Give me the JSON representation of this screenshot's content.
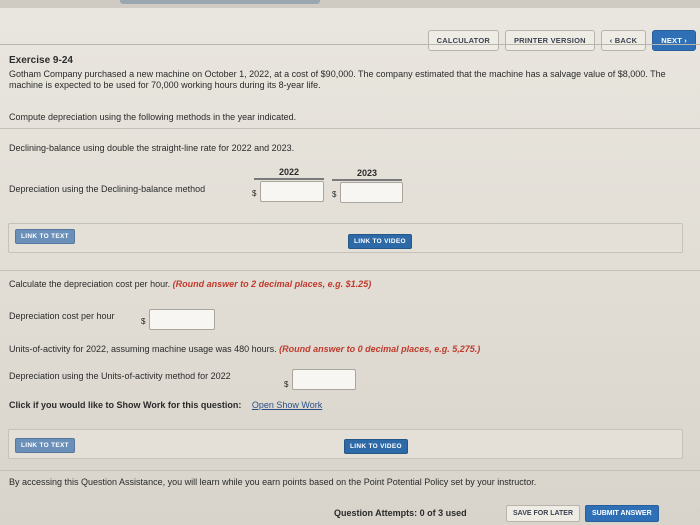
{
  "toolbar": {
    "calculator": "CALCULATOR",
    "printer_version": "PRINTER VERSION",
    "back": "‹ BACK",
    "next": "NEXT ›"
  },
  "exercise": {
    "title": "Exercise 9-24",
    "problem": "Gotham Company purchased a new machine on October 1, 2022, at a cost of $90,000. The company estimated that the machine has a salvage value of $8,000. The machine is expected to be used for 70,000 working hours during its 8-year life.",
    "instruction": "Compute depreciation using the following methods in the year indicated."
  },
  "part1": {
    "heading": "Declining-balance using double the straight-line rate for 2022 and 2023.",
    "col_2022": "2022",
    "col_2023": "2023",
    "row_label": "Depreciation using the Declining-balance method",
    "dollar": "$",
    "value_2022": "",
    "value_2023": "",
    "link_text": "LINK TO TEXT",
    "link_video": "LINK TO VIDEO"
  },
  "part2": {
    "instruction_prefix": "Calculate the depreciation cost per hour.",
    "instruction_round": "(Round answer to 2 decimal places, e.g. $1.25)",
    "cost_label": "Depreciation cost per hour",
    "dollar": "$",
    "cost_value": "",
    "units_prefix": "Units-of-activity for 2022, assuming machine usage was 480 hours.",
    "units_round": "(Round answer to 0 decimal places, e.g. 5,275.)",
    "units_label": "Depreciation using the Units-of-activity method for 2022",
    "units_value": "",
    "show_work_label": "Click if you would like to Show Work for this question:",
    "show_work_link": "Open Show Work",
    "link_text": "LINK TO TEXT",
    "link_video": "LINK TO VIDEO"
  },
  "footer": {
    "notice": "By accessing this Question Assistance, you will learn while you earn points based on the Point Potential Policy set by your instructor.",
    "attempts": "Question Attempts: 0 of 3 used",
    "save_later": "SAVE FOR LATER",
    "submit": "SUBMIT ANSWER"
  },
  "colors": {
    "accent": "#2f6fb5",
    "emphasis": "#c0392b",
    "background": "#e6e2db"
  }
}
